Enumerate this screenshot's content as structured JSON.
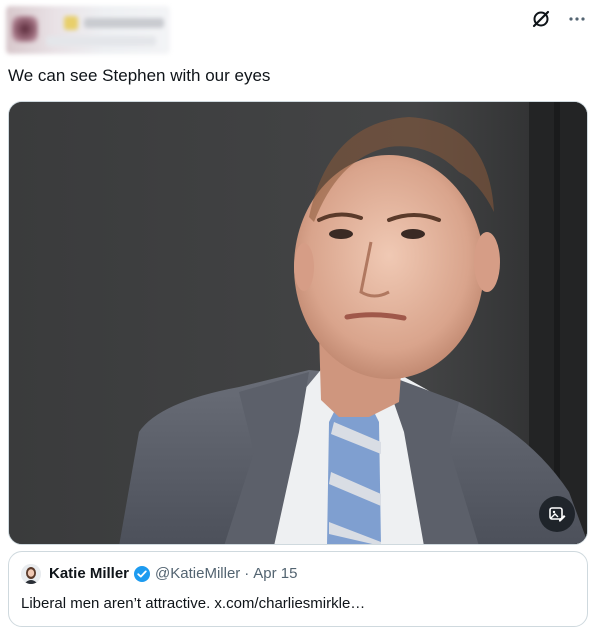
{
  "tweet": {
    "text": "We can see Stephen with our eyes"
  },
  "media": {
    "alt_icon": "image-edit-icon"
  },
  "quote": {
    "name": "Katie Miller",
    "handle": "@KatieMiller",
    "separator": "·",
    "date": "Apr 15",
    "text": "Liberal men aren’t attractive. x.com/charliesmirkle…"
  },
  "icons": {
    "grok": "grok-icon",
    "more": "more-icon",
    "verified": "verified-badge-icon"
  },
  "colors": {
    "text": "#0f1419",
    "secondary": "#536471",
    "border": "#cfd9de",
    "verified": "#1d9bf0"
  }
}
